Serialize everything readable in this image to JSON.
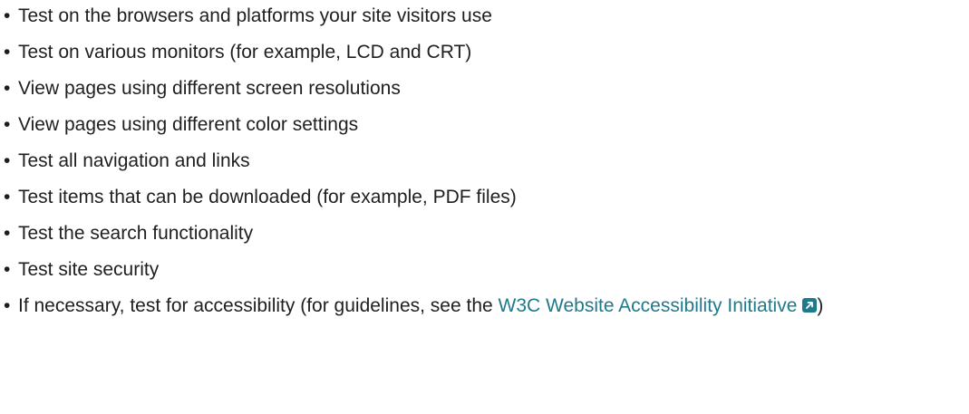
{
  "checklist": {
    "items": [
      "Test on the browsers and platforms your site visitors use",
      "Test on various monitors (for example, LCD and CRT)",
      "View pages using different screen resolutions",
      "View pages using different color settings",
      "Test all navigation and links",
      "Test items that can be downloaded (for example, PDF files)",
      "Test the search functionality",
      "Test site security"
    ],
    "last_item": {
      "prefix": "If necessary, test for accessibility (for guidelines, see the ",
      "link_text": "W3C Website Accessibility Initiative",
      "suffix": ")"
    },
    "bullet": "•",
    "link_color": "#1f7a8c",
    "link_icon": "external-link-icon"
  }
}
